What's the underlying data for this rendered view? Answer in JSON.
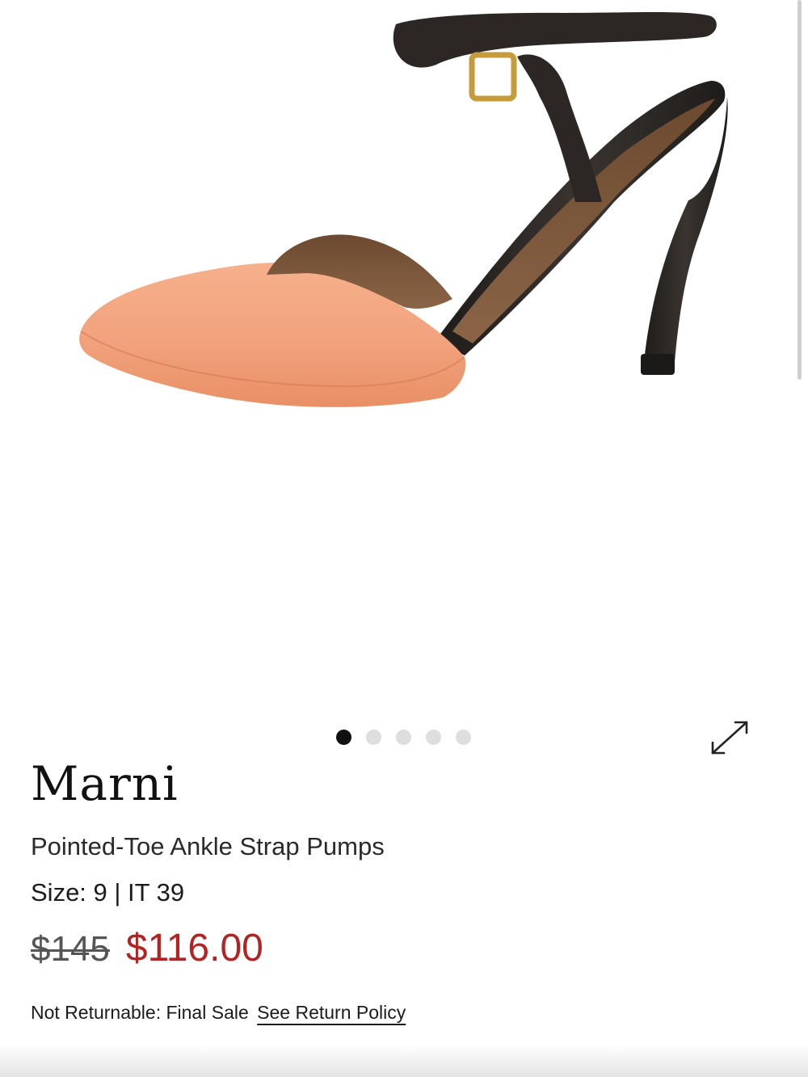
{
  "product": {
    "image_alt": "Marni pointed-toe ankle strap pump, peach leather with dark brown strap and heel",
    "brand": "Marni",
    "title": "Pointed-Toe Ankle Strap Pumps",
    "size": "Size: 9 | IT 39",
    "price_original": "$145",
    "price_sale": "$116.00",
    "return_note": "Not Returnable: Final Sale",
    "return_link": "See Return Policy"
  },
  "carousel": {
    "total": 5,
    "active_index": 0
  },
  "icons": {
    "expand": "expand-arrows-icon"
  },
  "colors": {
    "sale_price": "#b22424",
    "original_price": "#555555",
    "dot_active": "#111111",
    "dot_inactive": "#dedede",
    "shoe_peach": "#f1a27c",
    "shoe_dark": "#2e2a26"
  }
}
